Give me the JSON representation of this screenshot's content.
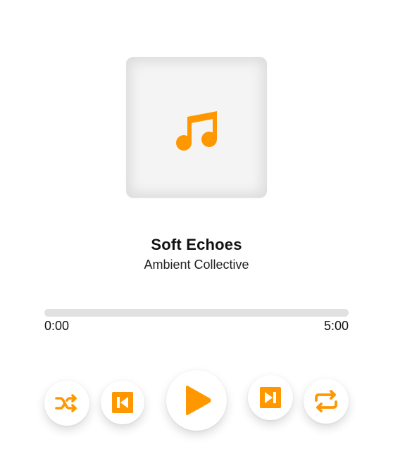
{
  "track": {
    "title": "Soft Echoes",
    "artist": "Ambient Collective",
    "art_icon": "music-note-icon"
  },
  "progress": {
    "current": "0:00",
    "total": "5:00",
    "fraction": 0
  },
  "controls": {
    "shuffle": "shuffle-icon",
    "previous": "skip-previous-icon",
    "play": "play-icon",
    "next": "skip-next-icon",
    "repeat": "repeat-icon"
  },
  "colors": {
    "accent": "#ff9800",
    "track_bg": "#e1e1e1",
    "text": "#111111"
  }
}
